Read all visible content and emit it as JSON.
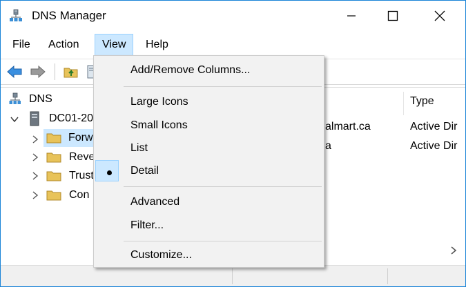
{
  "window": {
    "title": "DNS Manager",
    "min_icon": "minimize-icon",
    "max_icon": "maximize-icon",
    "close_icon": "close-icon"
  },
  "menubar": {
    "items": [
      "File",
      "Action",
      "View",
      "Help"
    ]
  },
  "toolbar": {
    "icons": [
      "back-arrow-icon",
      "forward-arrow-icon",
      "up-folder-icon",
      "show-hide-console-tree-icon"
    ]
  },
  "tree": {
    "root": "DNS",
    "server": "DC01-20",
    "children": [
      "Forw",
      "Reve",
      "Trust",
      "Con"
    ]
  },
  "list": {
    "columns": [
      "Type"
    ],
    "rows": [
      {
        "name_partial": "almart.ca",
        "type": "Active Dir"
      },
      {
        "name_partial": "a",
        "type": "Active Dir"
      }
    ]
  },
  "view_menu": {
    "items": [
      {
        "label": "Add/Remove Columns...",
        "checked": false
      },
      {
        "label": "Large Icons",
        "checked": false
      },
      {
        "label": "Small Icons",
        "checked": false
      },
      {
        "label": "List",
        "checked": false
      },
      {
        "label": "Detail",
        "checked": true
      },
      {
        "label": "Advanced",
        "checked": false
      },
      {
        "label": "Filter...",
        "checked": false
      },
      {
        "label": "Customize...",
        "checked": false
      }
    ]
  },
  "colors": {
    "accent": "#1883d7",
    "menu_highlight": "#cce8ff",
    "menu_highlight_border": "#99d1ff",
    "folder": "#e8c35a"
  }
}
